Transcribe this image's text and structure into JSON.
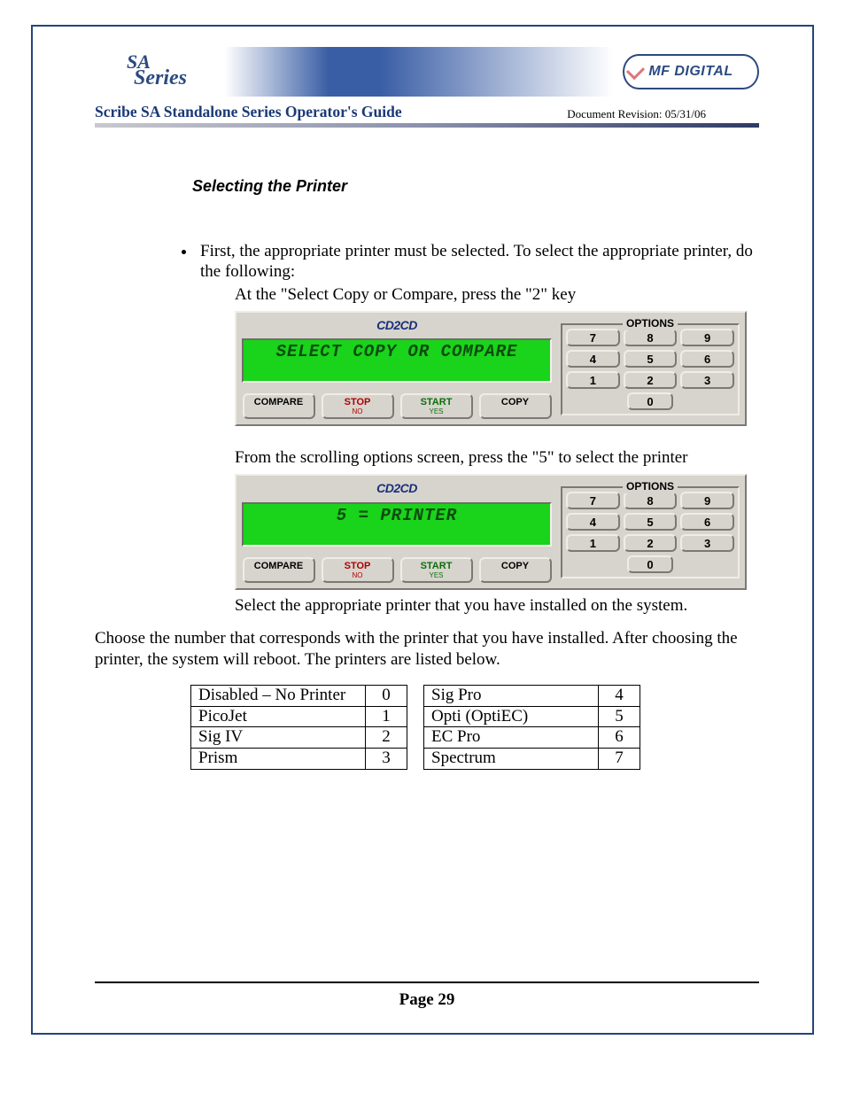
{
  "header": {
    "logo_line1": "SA",
    "logo_line2": "Series",
    "right_logo": "MF DIGITAL",
    "guide_title": "Scribe SA Standalone Series Operator's Guide",
    "doc_revision": "Document Revision: 05/31/06"
  },
  "section_title": "Selecting the Printer",
  "bullet_text": "First, the appropriate printer must be selected.  To select the appropriate printer, do the following:",
  "line1": "At the \"Select Copy or Compare,  press the \"2\" key",
  "line2": "From the scrolling options screen, press the \"5\" to select the printer",
  "line3": "Select the appropriate printer that you have installed on the system.",
  "para": "Choose the number that corresponds with the printer that you have  installed.  After choosing the printer, the system will reboot.  The printers are listed below.",
  "panel": {
    "brand": "CD2CD",
    "lcd1": "SELECT COPY OR COMPARE",
    "lcd2": "5 = PRINTER",
    "btn_compare": "COMPARE",
    "btn_stop": "STOP",
    "btn_stop_sub": "NO",
    "btn_start": "START",
    "btn_start_sub": "YES",
    "btn_copy": "COPY",
    "options_label": "OPTIONS",
    "keys": [
      "7",
      "8",
      "9",
      "4",
      "5",
      "6",
      "1",
      "2",
      "3",
      "0"
    ]
  },
  "printers_left": [
    {
      "name": "Disabled – No Printer",
      "num": "0"
    },
    {
      "name": "PicoJet",
      "num": "1"
    },
    {
      "name": "Sig IV",
      "num": "2"
    },
    {
      "name": "Prism",
      "num": "3"
    }
  ],
  "printers_right": [
    {
      "name": "Sig Pro",
      "num": "4"
    },
    {
      "name": "Opti (OptiEC)",
      "num": "5"
    },
    {
      "name": "EC Pro",
      "num": "6"
    },
    {
      "name": "Spectrum",
      "num": "7"
    }
  ],
  "page_number": "Page 29"
}
